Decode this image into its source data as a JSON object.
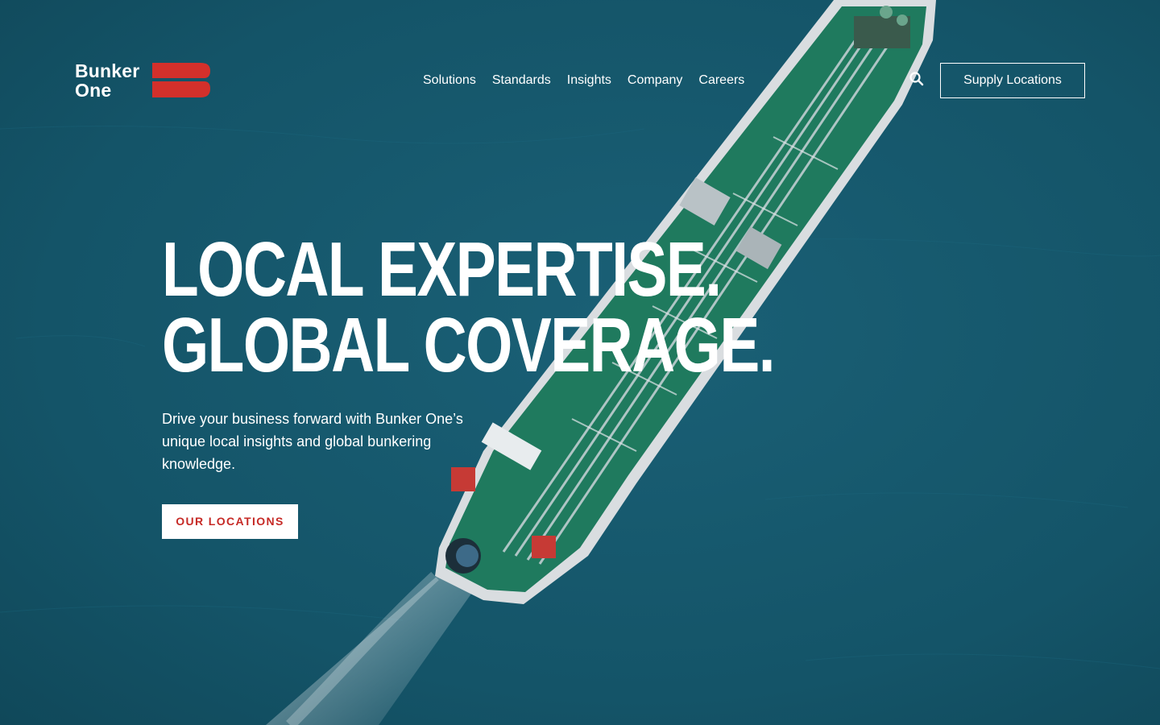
{
  "brand": {
    "name_line1": "Bunker",
    "name_line2": "One",
    "accent_color": "#d3302b",
    "logo_icon": "bunker-one-stripes-logo"
  },
  "nav": {
    "items": [
      {
        "label": "Solutions"
      },
      {
        "label": "Standards"
      },
      {
        "label": "Insights"
      },
      {
        "label": "Company"
      },
      {
        "label": "Careers"
      }
    ],
    "search_icon": "search-icon",
    "supply_button_label": "Supply Locations"
  },
  "hero": {
    "title_line1": "LOCAL EXPERTISE.",
    "title_line2": "GLOBAL COVERAGE.",
    "subtitle": "Drive your business forward with Bunker One’s unique local insights and global bunkering knowledge.",
    "cta_label": "OUR LOCATIONS",
    "background": "aerial-tanker-ship-on-sea",
    "sea_color": "#155468",
    "deck_color": "#1f7a5e"
  }
}
